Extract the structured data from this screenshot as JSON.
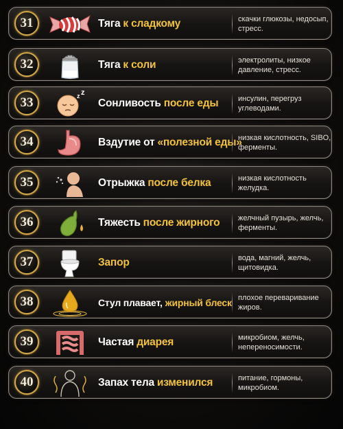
{
  "rows": [
    {
      "num": "31",
      "title": "Тяга",
      "highlight": "к сладкому",
      "note": "скачки глюкозы, недосып, стресс.",
      "icon": "candy-icon"
    },
    {
      "num": "32",
      "title": "Тяга",
      "highlight": "к соли",
      "note": "электролиты, низкое давление, стресс.",
      "icon": "salt-shaker-icon"
    },
    {
      "num": "33",
      "title": "Сонливость",
      "highlight": "после еды",
      "note": "инсулин, перегруз углеводами.",
      "icon": "sleepy-face-icon"
    },
    {
      "num": "34",
      "title": "Вздутие от",
      "highlight": "«полезной еды»",
      "note": "низкая кислотность, SIBO, ферменты.",
      "icon": "stomach-icon"
    },
    {
      "num": "35",
      "title": "Отрыжка",
      "highlight": "после белка",
      "note": "низкая кислотность желудка.",
      "icon": "person-burp-icon"
    },
    {
      "num": "36",
      "title": "Тяжесть",
      "highlight": "после жирного",
      "note": "желчный пузырь, желчь, ферменты.",
      "icon": "gallbladder-icon"
    },
    {
      "num": "37",
      "title": "Запор",
      "highlight": "",
      "note": "вода, магний, желчь, щитовидка.",
      "icon": "toilet-icon"
    },
    {
      "num": "38",
      "title": "Стул плавает,",
      "highlight": "жирный блеск",
      "note": "плохое переваривание жиров.",
      "icon": "oil-drop-icon"
    },
    {
      "num": "39",
      "title": "Частая",
      "highlight": "диарея",
      "note": "микробиом, желчь, непереносимости.",
      "icon": "intestine-icon"
    },
    {
      "num": "40",
      "title": "Запах тела",
      "highlight": "изменился",
      "note": "питание, гормоны, микробиом.",
      "icon": "body-odor-icon"
    }
  ],
  "colors": {
    "accent": "#f2c23c",
    "badge_ring": "#d2a84a",
    "text": "#ffffff",
    "note": "#e6e1d8",
    "background": "#0b0a09"
  }
}
